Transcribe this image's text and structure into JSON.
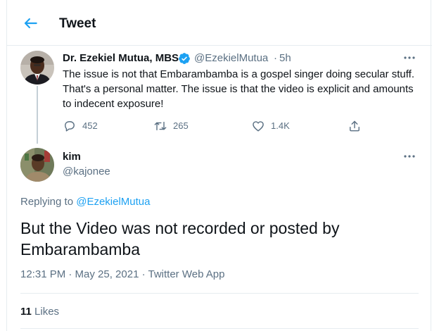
{
  "header": {
    "title": "Tweet",
    "back_icon": "arrow-left-icon"
  },
  "colors": {
    "accent": "#1da1f2",
    "text": "#0f1419",
    "muted": "#5b7083",
    "divider": "#e6ecf0"
  },
  "parent_tweet": {
    "name": "Dr. Ezekiel Mutua, MBS",
    "verified": true,
    "handle": "@EzekielMutua",
    "separator": "·",
    "time": "5h",
    "text_lines": [
      "The issue is not that Embarambamba is a gospel singer doing secular stuff.",
      "That's a personal matter. The issue is that the video is explicit and amounts",
      "to indecent exposure!"
    ],
    "actions": {
      "replies": "452",
      "retweets": "265",
      "likes": "1.4K"
    }
  },
  "reply_tweet": {
    "name": "kim",
    "handle": "@kajonee",
    "replying_prefix": "Replying to",
    "replying_to": "@EzekielMutua",
    "text_lines": [
      "But the Video was not recorded or posted by",
      "Embarambamba"
    ],
    "timestamp": "12:31 PM · May 25, 2021",
    "meta_separator": " · ",
    "source": "Twitter Web App",
    "like_count": "11",
    "like_label": "Likes"
  }
}
